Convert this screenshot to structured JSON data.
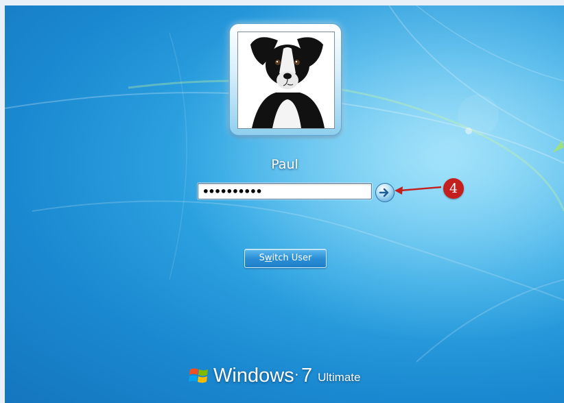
{
  "user": {
    "name": "Paul",
    "avatar_icon": "dog-photo"
  },
  "password": {
    "value": "••••••••••"
  },
  "submit": {
    "icon": "arrow-right-icon"
  },
  "switch_user": {
    "label_pre": "S",
    "label_underline": "w",
    "label_post": "itch User"
  },
  "callout": {
    "number": "4",
    "color": "#c41f1f"
  },
  "branding": {
    "product": "Windows",
    "version": "7",
    "edition": "Ultimate"
  },
  "colors": {
    "background": "#1f8dd3",
    "button": "#2c8fd6"
  }
}
